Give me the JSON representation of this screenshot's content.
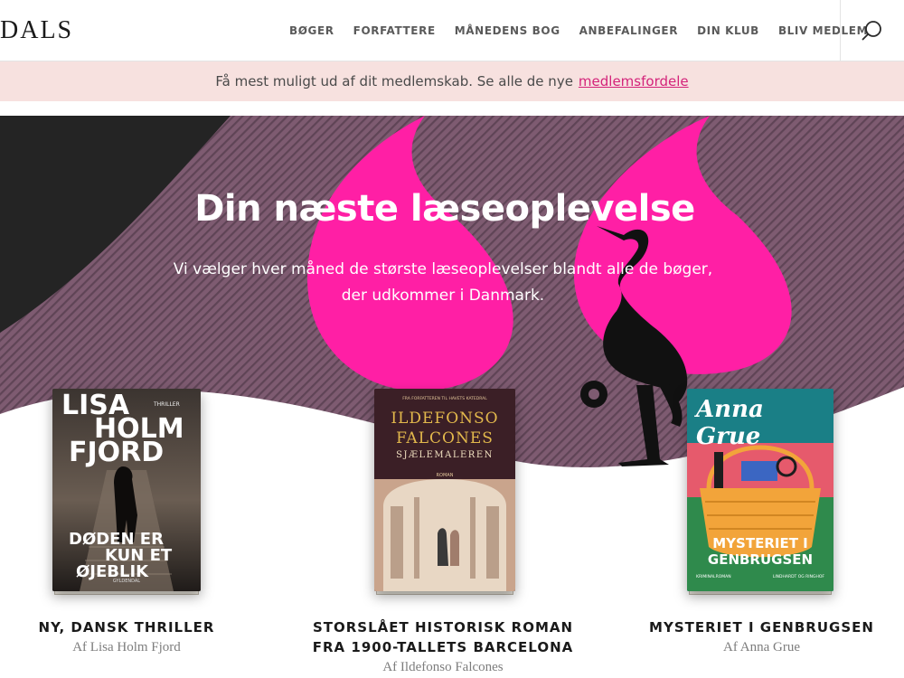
{
  "header": {
    "logo": "DALS",
    "nav": [
      "BØGER",
      "FORFATTERE",
      "MÅNEDENS BOG",
      "ANBEFALINGER",
      "DIN KLUB",
      "BLIV MEDLEM"
    ],
    "search_icon": "search-icon"
  },
  "promo": {
    "text": "Få mest muligt ud af dit medlemskab. Se alle de nye",
    "link": "medlemsfordele"
  },
  "hero": {
    "title": "Din næste læseoplevelse",
    "subtitle_line1": "Vi vælger hver måned de største læseoplevelser blandt alle de bøger,",
    "subtitle_line2": "der udkommer i Danmark."
  },
  "colors": {
    "accent_pink": "#ff1fa5",
    "hero_bg": "#7e5b71",
    "banner_bg": "#f7e1df",
    "link": "#d4237a"
  },
  "books": [
    {
      "cover_tag": "THRILLER",
      "cover_author": [
        "LISA",
        "HOLM",
        "FJORD"
      ],
      "cover_title": [
        "DØDEN ER",
        "KUN ET",
        "ØJEBLIK"
      ],
      "cover_publisher": "GYLDENDAL",
      "caption_title": [
        "NY, DANSK THRILLER"
      ],
      "caption_author": "Af Lisa Holm Fjord"
    },
    {
      "cover_tag": "FRA FORFATTEREN TIL HAVETS KATEDRAL",
      "cover_author": [
        "ILDEFONSO",
        "FALCONES"
      ],
      "cover_title": [
        "SJÆLEMALEREN"
      ],
      "cover_subtag": "ROMAN",
      "caption_title": [
        "STORSLÅET HISTORISK ROMAN",
        "FRA 1900-TALLETS BARCELONA"
      ],
      "caption_author": "Af Ildefonso Falcones"
    },
    {
      "cover_author": [
        "Anna Grue"
      ],
      "cover_title": [
        "MYSTERIET I",
        "GENBRUGSEN"
      ],
      "cover_footer": [
        "KRIMINALROMAN",
        "LINDHARDT OG RINGHOF"
      ],
      "caption_title": [
        "MYSTERIET I GENBRUGSEN"
      ],
      "caption_author": "Af Anna Grue"
    }
  ]
}
